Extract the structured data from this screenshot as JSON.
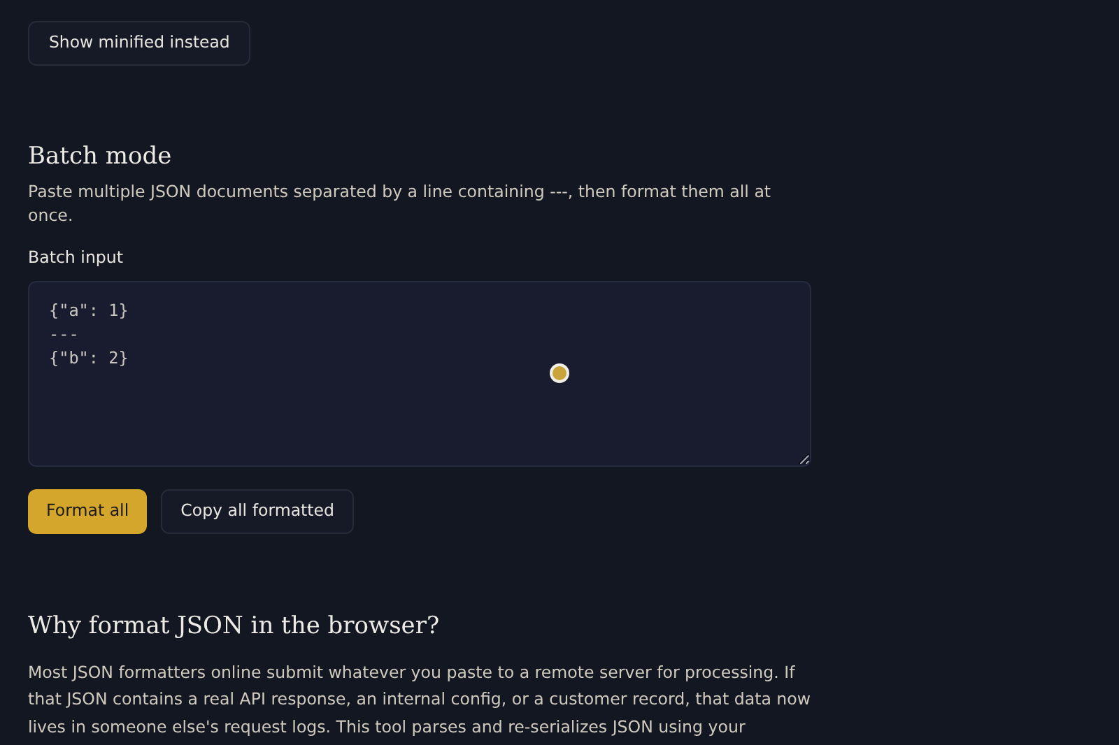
{
  "top_button": "Show minified instead",
  "batch": {
    "heading": "Batch mode",
    "description": "Paste multiple JSON documents separated by a line containing ---, then format them all at once.",
    "input_label": "Batch input",
    "input_value": "{\"a\": 1}\n---\n{\"b\": 2}",
    "buttons": [
      {
        "label": "Format all",
        "kind": "primary"
      },
      {
        "label": "Copy all formatted",
        "kind": "secondary"
      }
    ]
  },
  "why": {
    "heading": "Why format JSON in the browser?",
    "paragraph": "Most JSON formatters online submit whatever you paste to a remote server for processing. If that JSON contains a real API response, an internal config, or a customer record, that data now lives in someone else's request logs. This tool parses and re-serializes JSON using your"
  }
}
